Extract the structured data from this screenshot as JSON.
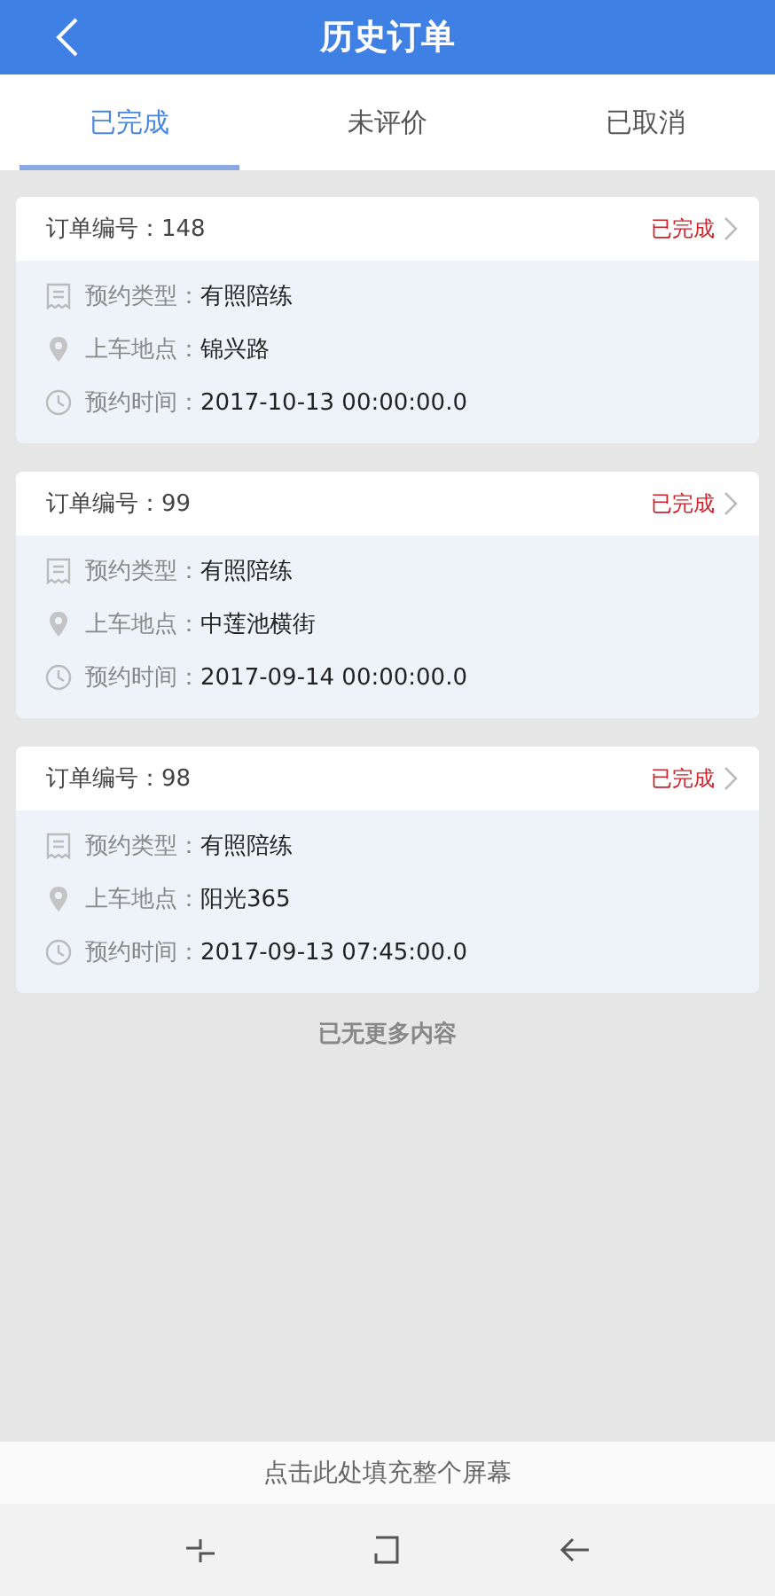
{
  "header": {
    "title": "历史订单"
  },
  "tabs": [
    {
      "label": "已完成",
      "selected": true
    },
    {
      "label": "未评价",
      "selected": false
    },
    {
      "label": "已取消",
      "selected": false
    }
  ],
  "orders": [
    {
      "number_label": "订单编号：148",
      "status": "已完成",
      "type": "预约类型：有照陪练",
      "location": "上车地点：锦兴路",
      "time": "预约时间：2017-10-13 00:00:00.0"
    },
    {
      "number_label": "订单编号：99",
      "status": "已完成",
      "type": "预约类型：有照陪练",
      "location": "上车地点：中莲池横街",
      "time": "预约时间：2017-09-14 00:00:00.0"
    },
    {
      "number_label": "订单编号：98",
      "status": "已完成",
      "type": "预约类型：有照陪练",
      "location": "上车地点：阳光365",
      "time": "预约时间：2017-09-13 07:45:00.0"
    }
  ],
  "end_note": "已无更多内容",
  "fill_screen_bar": "点击此处填充整个屏幕"
}
